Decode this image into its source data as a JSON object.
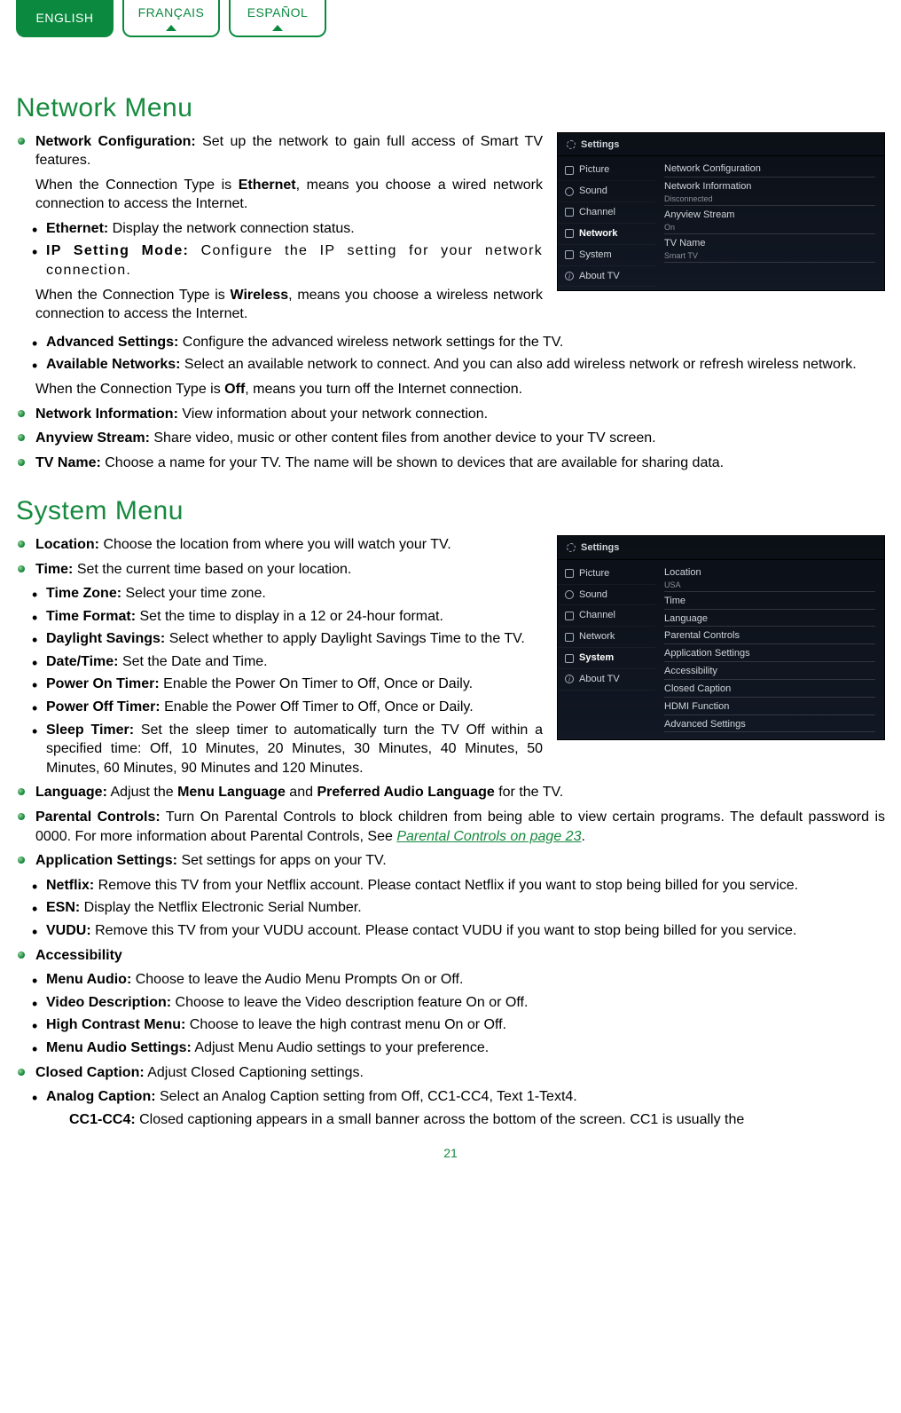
{
  "tabs": {
    "english": "ENGLISH",
    "francais": "FRANÇAIS",
    "espanol": "ESPAÑOL"
  },
  "page_number": "21",
  "section1": {
    "title": "Network Menu",
    "items": [
      {
        "b": "Network Configuration:",
        "t": " Set up the network to gain full access of Smart TV features."
      }
    ],
    "p_ethernet_a": "When the Connection Type is ",
    "p_ethernet_b": "Ethernet",
    "p_ethernet_c": ", means you choose a wired network connection to access the Internet.",
    "eth_items": [
      {
        "b": "Ethernet:",
        "t": " Display the network connection status."
      },
      {
        "b": "IP Setting Mode:",
        "t": " Configure the IP setting for your network connection.",
        "wide": true
      }
    ],
    "p_wireless_a": "When the Connection Type is ",
    "p_wireless_b": "Wireless",
    "p_wireless_c": ", means you choose a wireless network connection to access the Internet.",
    "wl_items": [
      {
        "b": "Advanced Settings:",
        "t": " Configure the advanced wireless network settings for the TV."
      },
      {
        "b": "Available Networks:",
        "t": " Select an available network to connect. And you can also add wireless network or refresh wireless network."
      }
    ],
    "p_off_a": "When the Connection Type is ",
    "p_off_b": "Off",
    "p_off_c": ", means you turn off the Internet connection.",
    "rest": [
      {
        "b": "Network Information:",
        "t": " View information about your network connection."
      },
      {
        "b": "Anyview Stream:",
        "t": " Share video, music or other content files from another device to your TV screen."
      },
      {
        "b": "TV Name:",
        "t": " Choose a name for your TV. The name will be shown to devices that are available for sharing data."
      }
    ]
  },
  "section2": {
    "title": "System Menu",
    "loc": {
      "b": "Location:",
      "t": " Choose the location from where you will watch your TV."
    },
    "time": {
      "b": "Time:",
      "t": " Set the current time based on your location."
    },
    "time_items": [
      {
        "b": "Time Zone:",
        "t": " Select your time zone."
      },
      {
        "b": "Time Format:",
        "t": " Set the time to display in a 12 or 24-hour format."
      },
      {
        "b": "Daylight Savings:",
        "t": " Select whether to apply Daylight Savings Time to the TV."
      },
      {
        "b": "Date/Time:",
        "t": " Set the Date and Time."
      },
      {
        "b": "Power On Timer:",
        "t": " Enable the Power On Timer to Off, Once or Daily."
      },
      {
        "b": "Power Off Timer:",
        "t": " Enable the Power Off Timer to Off, Once or Daily."
      },
      {
        "b": "Sleep Timer:",
        "t": " Set the sleep timer to automatically turn the TV Off within a specified time: Off, 10 Minutes, 20 Minutes, 30 Minutes, 40 Minutes, 50 Minutes, 60 Minutes, 90 Minutes and 120 Minutes."
      }
    ],
    "lang_a": "Language:",
    "lang_b": " Adjust the ",
    "lang_c": "Menu Language",
    "lang_d": " and ",
    "lang_e": "Preferred Audio Language",
    "lang_f": " for the TV.",
    "pc_a": "Parental Controls:",
    "pc_b": " Turn On Parental Controls to block children from being able to view certain programs. The default password is 0000. For more information about Parental Controls, See ",
    "pc_link": "Parental Controls on page 23",
    "pc_c": ".",
    "appset": {
      "b": "Application Settings:",
      "t": " Set settings for apps on your TV."
    },
    "app_items": [
      {
        "b": "Netflix:",
        "t": " Remove this TV from your Netflix account. Please contact Netflix if you want to stop being billed for you service."
      },
      {
        "b": "ESN:",
        "t": " Display the Netflix Electronic Serial Number."
      },
      {
        "b": "VUDU:",
        "t": " Remove this TV from your VUDU account. Please contact VUDU if you want to stop being billed for you service."
      }
    ],
    "acc_title": "Accessibility",
    "acc_items": [
      {
        "b": "Menu Audio:",
        "t": " Choose to leave the Audio Menu Prompts On or Off."
      },
      {
        "b": "Video Description:",
        "t": " Choose to leave the Video description feature On or Off."
      },
      {
        "b": "High Contrast Menu:",
        "t": " Choose to leave the high contrast menu On or Off."
      },
      {
        "b": "Menu Audio Settings:",
        "t": " Adjust Menu Audio settings to your preference."
      }
    ],
    "cc": {
      "b": "Closed Caption:",
      "t": " Adjust Closed Captioning settings."
    },
    "cc_items": [
      {
        "b": "Analog Caption:",
        "t": " Select an Analog Caption setting from Off, CC1-CC4, Text 1-Text4."
      }
    ],
    "cc_sub_b": "CC1-CC4:",
    "cc_sub_t": " Closed captioning appears in a small banner across the bottom of the screen. CC1 is usually the"
  },
  "shot1": {
    "header": "Settings",
    "left": [
      "Picture",
      "Sound",
      "Channel",
      "Network",
      "System",
      "About TV"
    ],
    "active": "Network",
    "right": [
      {
        "label": "Network Configuration",
        "sub": ""
      },
      {
        "label": "Network Information",
        "sub": "Disconnected"
      },
      {
        "label": "Anyview Stream",
        "sub": "On"
      },
      {
        "label": "TV Name",
        "sub": "Smart TV"
      }
    ]
  },
  "shot2": {
    "header": "Settings",
    "left": [
      "Picture",
      "Sound",
      "Channel",
      "Network",
      "System",
      "About TV"
    ],
    "active": "System",
    "right": [
      {
        "label": "Location",
        "sub": "USA"
      },
      {
        "label": "Time",
        "sub": ""
      },
      {
        "label": "Language",
        "sub": ""
      },
      {
        "label": "Parental Controls",
        "sub": ""
      },
      {
        "label": "Application Settings",
        "sub": ""
      },
      {
        "label": "Accessibility",
        "sub": ""
      },
      {
        "label": "Closed Caption",
        "sub": ""
      },
      {
        "label": "HDMI Function",
        "sub": ""
      },
      {
        "label": "Advanced Settings",
        "sub": ""
      }
    ]
  }
}
